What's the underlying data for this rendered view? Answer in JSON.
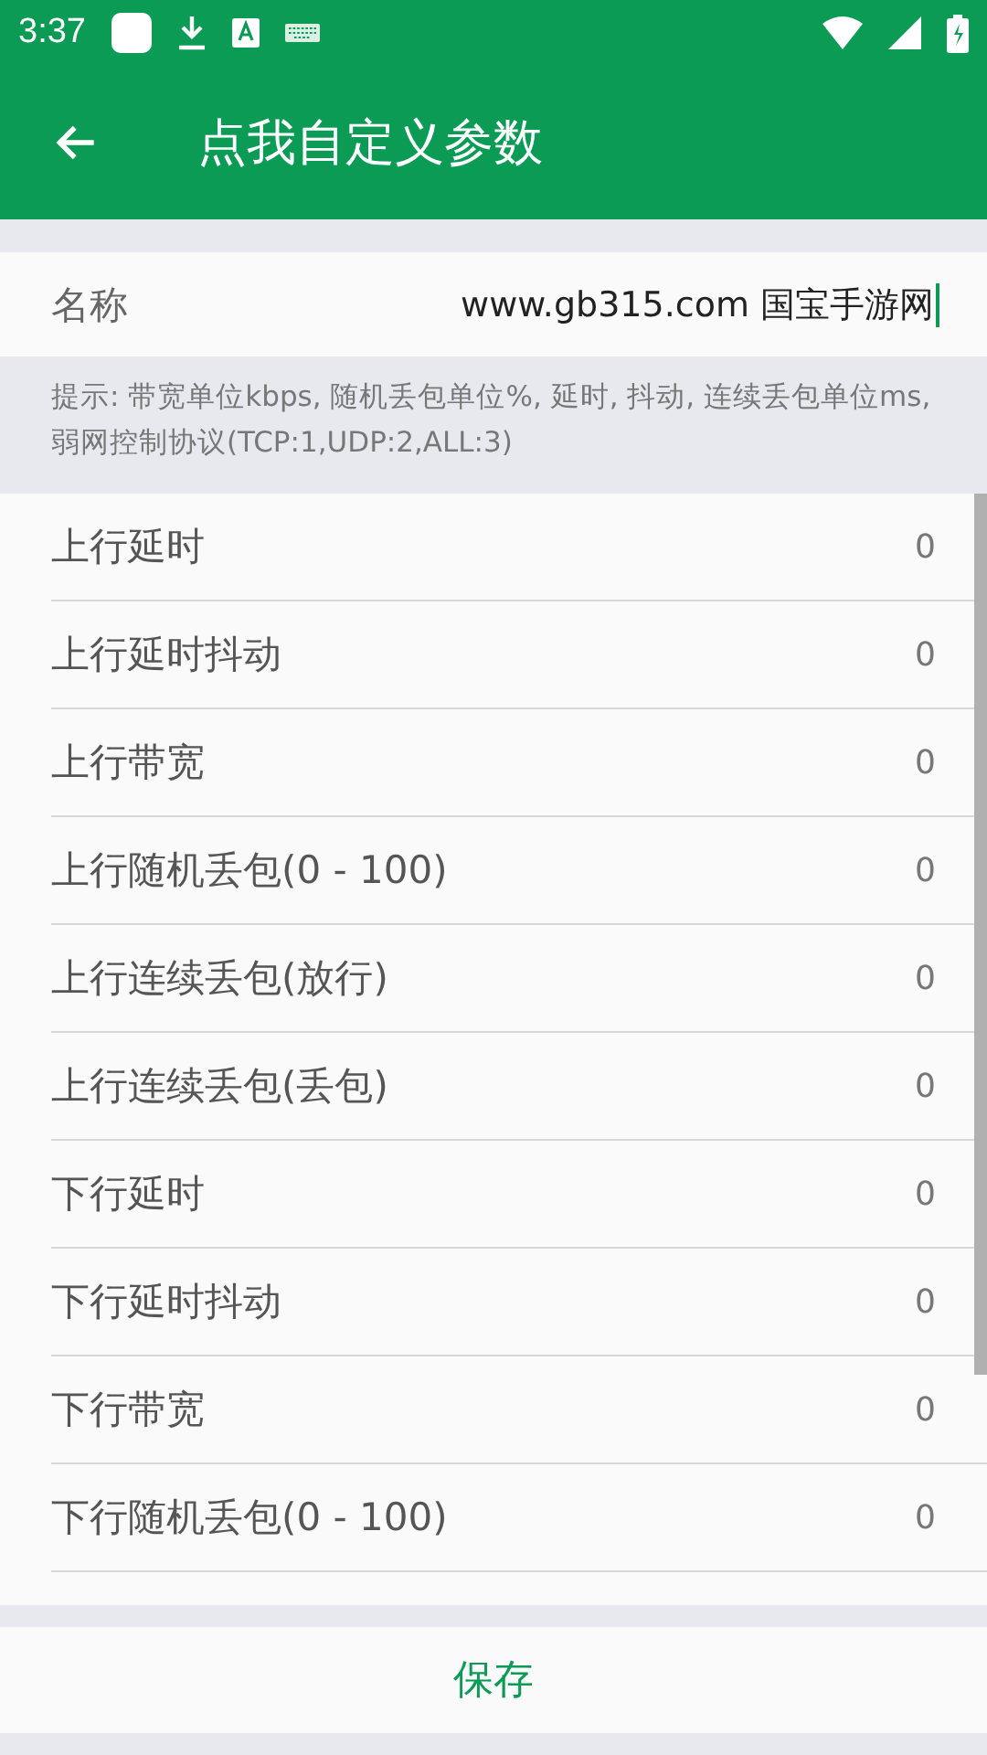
{
  "status_bar": {
    "time": "3:37"
  },
  "app_bar": {
    "title": "点我自定义参数"
  },
  "name_field": {
    "label": "名称",
    "value": "www.gb315.com 国宝手游网"
  },
  "hint": "提示: 带宽单位kbps, 随机丢包单位%, 延时, 抖动, 连续丢包单位ms, 弱网控制协议(TCP:1,UDP:2,ALL:3)",
  "params": [
    {
      "label": "上行延时",
      "value": "0"
    },
    {
      "label": "上行延时抖动",
      "value": "0"
    },
    {
      "label": "上行带宽",
      "value": "0"
    },
    {
      "label": "上行随机丢包(0 - 100)",
      "value": "0"
    },
    {
      "label": "上行连续丢包(放行)",
      "value": "0"
    },
    {
      "label": "上行连续丢包(丢包)",
      "value": "0"
    },
    {
      "label": "下行延时",
      "value": "0"
    },
    {
      "label": "下行延时抖动",
      "value": "0"
    },
    {
      "label": "下行带宽",
      "value": "0"
    },
    {
      "label": "下行随机丢包(0 - 100)",
      "value": "0"
    }
  ],
  "save_button": "保存"
}
